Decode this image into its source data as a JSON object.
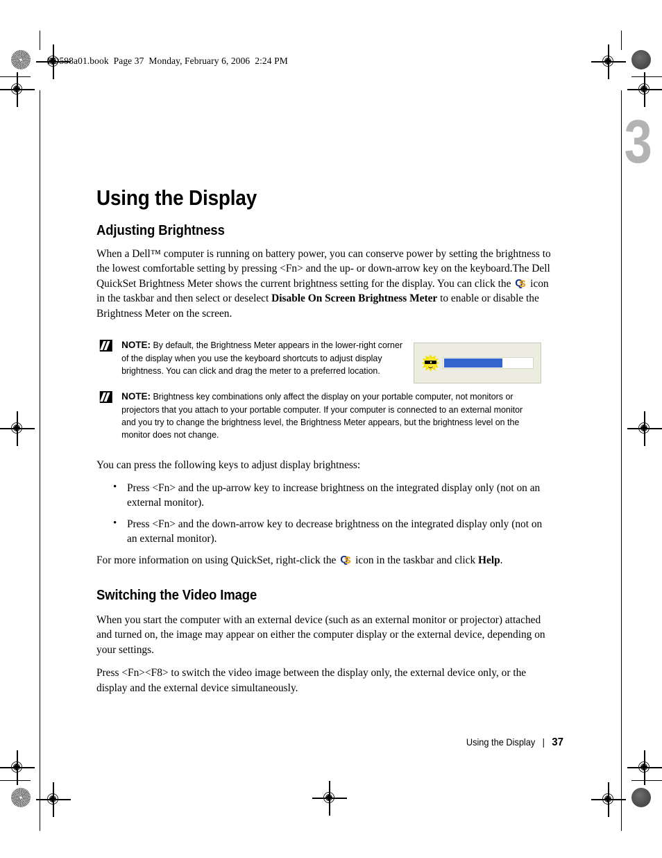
{
  "page": {
    "header_line": "PD598a01.book  Page 37  Monday, February 6, 2006  2:24 PM",
    "chapter_number": "3",
    "chapter_title": "Using the Display"
  },
  "sections": [
    {
      "heading": "Adjusting Brightness",
      "intro_part_1": "When a Dell™ computer is running on battery power, you can conserve power by setting the brightness to the lowest comfortable setting by pressing <Fn> and the up- or down-arrow key on the keyboard.The Dell QuickSet Brightness Meter shows the current brightness setting for the display. You can click the ",
      "intro_part_2": " icon in the taskbar and then select or deselect ",
      "intro_bold_1": "Disable On Screen Brightness Meter",
      "intro_part_3": " to enable or disable the Brightness Meter on the screen.",
      "notes": [
        {
          "label": "NOTE:",
          "text": " By default, the Brightness Meter appears in the lower-right corner of the display when you use the keyboard shortcuts to adjust display brightness. You can click and drag the meter to a preferred location."
        },
        {
          "label": "NOTE:",
          "text": " Brightness key combinations only affect the display on your portable computer, not monitors or projectors that you attach to your portable computer. If your computer is connected to an external monitor and you try to change the brightness level, the Brightness Meter appears, but the brightness level on the monitor does not change."
        }
      ],
      "list_intro": "You can press the following keys to adjust display brightness:",
      "bullets": [
        "Press <Fn> and the up-arrow key to increase brightness on the integrated display only (not on an external monitor).",
        "Press <Fn> and the down-arrow key to decrease brightness on the integrated display only (not on an external monitor)."
      ],
      "outro_part_1": "For more information on using QuickSet, right-click the ",
      "outro_part_2": " icon in the taskbar and click ",
      "outro_bold_1": "Help",
      "outro_part_3": "."
    },
    {
      "heading": "Switching the Video Image",
      "paragraphs": [
        "When you start the computer with an external device (such as an external monitor or projector) attached and turned on, the image may appear on either the computer display or the external device, depending on your settings.",
        "Press <Fn><F8> to switch the video image between the display only, the external device only, or the display and the external device simultaneously."
      ]
    }
  ],
  "figure": {
    "name": "brightness-meter",
    "icon": "sun-with-sunglasses-icon",
    "fill_percent": 65,
    "bar_color": "#3366cc",
    "background_color": "#ecece0"
  },
  "icons": {
    "quickset": {
      "name": "quickset-icon",
      "letter_q": "Q",
      "letter_s": "S",
      "q_color": "#12308f",
      "s_color": "#f0a515"
    },
    "note": {
      "name": "note-pencil-icon"
    }
  },
  "footer": {
    "running_title": "Using the Display",
    "separator": "|",
    "page_number": "37"
  }
}
